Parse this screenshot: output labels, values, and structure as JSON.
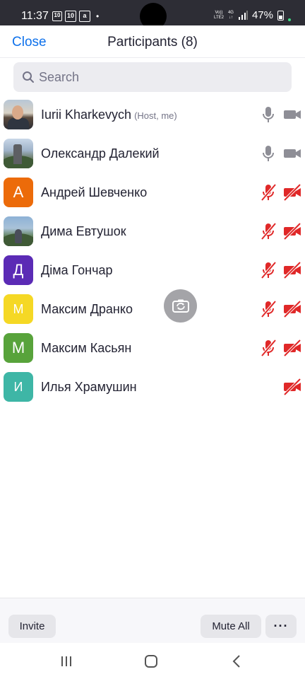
{
  "status_bar": {
    "time": "11:37",
    "badge_1": "10",
    "badge_2": "10",
    "badge_3": "a",
    "dot": "•",
    "volte": "Vo))\nLTE2",
    "network": "4G",
    "battery": "47%"
  },
  "header": {
    "close_label": "Close",
    "title": "Participants (8)"
  },
  "search": {
    "placeholder": "Search"
  },
  "participants": [
    {
      "name": "Iurii Kharkevych",
      "suffix": "(Host, me)",
      "avatar_type": "photo",
      "mic": "on",
      "video": "on"
    },
    {
      "name": "Олександр Далекий",
      "avatar_type": "photo",
      "mic": "on",
      "video": "on"
    },
    {
      "name": "Андрей Шевченко",
      "avatar_type": "letter",
      "initial": "А",
      "avatar_color": "#ec6b0a",
      "mic": "muted",
      "video": "off"
    },
    {
      "name": "Дима Евтушок",
      "avatar_type": "photo",
      "mic": "muted",
      "video": "off"
    },
    {
      "name": "Діма Гончар",
      "avatar_type": "letter",
      "initial": "Д",
      "avatar_color": "#5b2bb5",
      "mic": "muted",
      "video": "off"
    },
    {
      "name": "Максим Дранко",
      "avatar_type": "letter",
      "initial": "М",
      "avatar_color": "#f5d825",
      "mic": "muted",
      "video": "off"
    },
    {
      "name": "Максим Касьян",
      "avatar_type": "letter",
      "initial": "М",
      "avatar_color": "#58a33b",
      "mic": "muted",
      "video": "off"
    },
    {
      "name": "Илья Храмушин",
      "avatar_type": "letter",
      "initial": "И",
      "avatar_color": "#3eb6a6",
      "mic": "none",
      "video": "off"
    }
  ],
  "toolbar": {
    "invite_label": "Invite",
    "mute_all_label": "Mute All",
    "more_label": "···"
  },
  "colors": {
    "accent": "#0e71eb",
    "muted_red": "#e02828",
    "icon_gray": "#8e8e96"
  },
  "icons": {
    "floating": "camera-switch-icon",
    "mic_on": "microphone-icon",
    "mic_muted": "microphone-muted-icon",
    "video_on": "video-camera-icon",
    "video_off": "video-camera-off-icon"
  }
}
